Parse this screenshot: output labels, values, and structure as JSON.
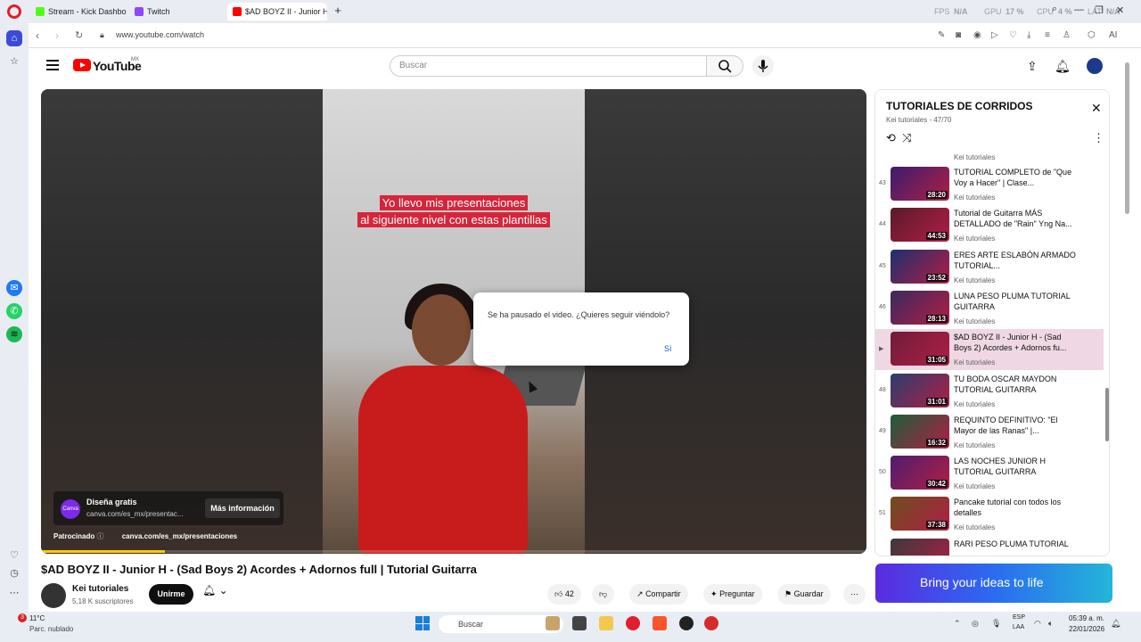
{
  "browser": {
    "tabs": [
      {
        "label": "Stream - Kick Dashboard",
        "color": "#53fc18"
      },
      {
        "label": "Twitch",
        "color": "#9146ff"
      },
      {
        "label": "$AD BOYZ II - Junior H - (",
        "color": "#ff0000"
      }
    ],
    "perf": {
      "fps_label": "FPS",
      "fps_value": "N/A",
      "gpu_label": "GPU",
      "gpu_value": "17 %",
      "cpu_label": "CPU",
      "cpu_value": "4 %",
      "lat_label": "LAT",
      "lat_value": "N/A"
    },
    "url": "www.youtube.com/watch",
    "ai_label": "AI"
  },
  "youtube": {
    "logo_text": "YouTube",
    "country": "MX",
    "search_placeholder": "Buscar"
  },
  "player": {
    "caption_line1": "Yo llevo mis presentaciones",
    "caption_line2": "al siguiente nivel con estas plantillas",
    "ad": {
      "logo_text": "Canva",
      "title": "Diseña gratis",
      "url": "canva.com/es_mx/presentac...",
      "cta": "Más información",
      "sponsored_label": "Patrocinado",
      "sponsored_url": "canva.com/es_mx/presentaciones"
    },
    "progress_fraction": 0.15
  },
  "dialog": {
    "message": "Se ha pausado el video. ¿Quieres seguir viéndolo?",
    "confirm": "Sí"
  },
  "video": {
    "title": "$AD BOYZ II - Junior H - (Sad Boys 2) Acordes + Adornos full | Tutorial Guitarra",
    "channel": "Kei tutoriales",
    "subscribers": "5,18 K suscriptores",
    "join_label": "Unirme",
    "likes": "42",
    "share_label": "Compartir",
    "ask_label": "Preguntar",
    "save_label": "Guardar"
  },
  "playlist": {
    "title": "TUTORIALES DE CORRIDOS",
    "subtitle": "Kei tutoriales - 47/70",
    "partial_channel": "Kei tutoriales",
    "items": [
      {
        "num": "43",
        "title": "TUTORIAL COMPLETO de \"Que Voy a Hacer\" | Clase...",
        "channel": "Kei tutoriales",
        "duration": "28:20",
        "active": false
      },
      {
        "num": "44",
        "title": "Tutorial de Guitarra MÁS DETALLADO de \"Rain\" Yng Na...",
        "channel": "Kei tutoriales",
        "duration": "44:53",
        "active": false
      },
      {
        "num": "45",
        "title": "ERES ARTE ESLABÓN ARMADO TUTORIAL...",
        "channel": "Kei tutoriales",
        "duration": "23:52",
        "active": false
      },
      {
        "num": "46",
        "title": "LUNA PESO PLUMA TUTORIAL GUITARRA",
        "channel": "Kei tutoriales",
        "duration": "28:13",
        "active": false
      },
      {
        "num": "▶",
        "title": "$AD BOYZ II - Junior H - (Sad Boys 2) Acordes + Adornos fu...",
        "channel": "Kei tutoriales",
        "duration": "31:05",
        "active": true
      },
      {
        "num": "48",
        "title": "TU BODA OSCAR MAYDON TUTORIAL GUITARRA",
        "channel": "Kei tutoriales",
        "duration": "31:01",
        "active": false
      },
      {
        "num": "49",
        "title": "REQUINTO DEFINITIVO: \"El Mayor de las Ranas\" |...",
        "channel": "Kei tutoriales",
        "duration": "16:32",
        "active": false
      },
      {
        "num": "50",
        "title": "LAS NOCHES JUNIOR H TUTORIAL GUITARRA",
        "channel": "Kei tutoriales",
        "duration": "30:42",
        "active": false
      },
      {
        "num": "51",
        "title": "Pancake tutorial con todos los detalles",
        "channel": "Kei tutoriales",
        "duration": "37:38",
        "active": false
      },
      {
        "num": "",
        "title": "RARI PESO PLUMA TUTORIAL",
        "channel": "",
        "duration": "",
        "active": false
      }
    ]
  },
  "banner": {
    "text": "Bring your ideas to life"
  },
  "taskbar": {
    "weather_temp": "11°C",
    "weather_desc": "Parc. nublado",
    "weather_badge": "3",
    "search_label": "Buscar",
    "lang_line1": "ESP",
    "lang_line2": "LAA",
    "time": "05:39 a. m.",
    "date": "22/01/2026"
  }
}
